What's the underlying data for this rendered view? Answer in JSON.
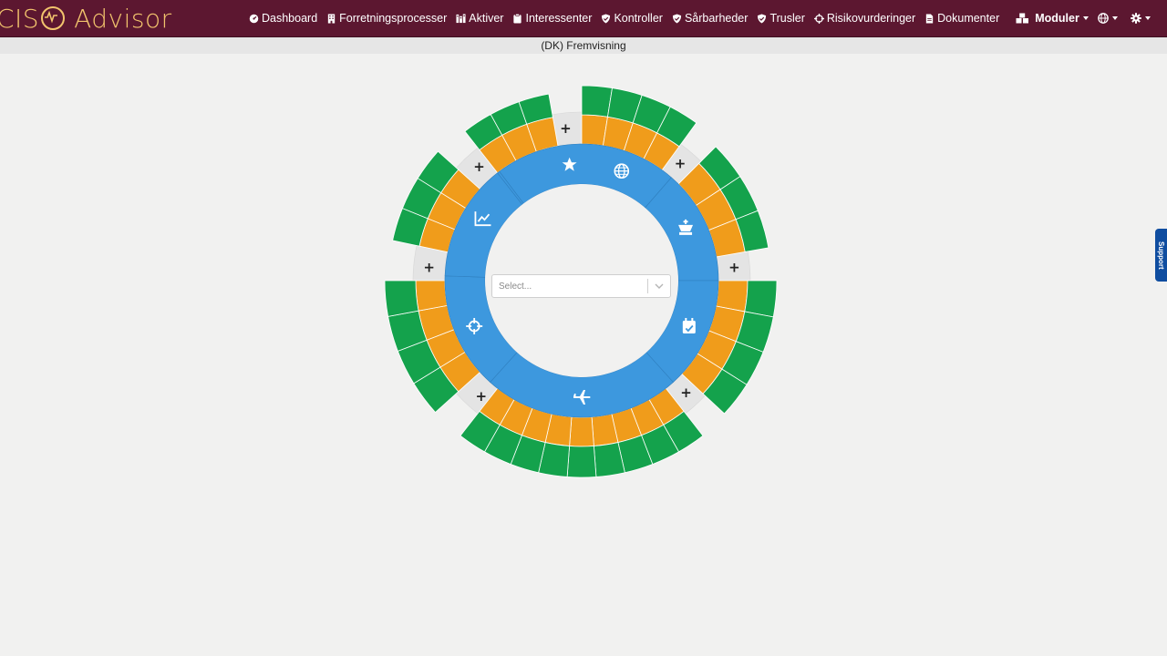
{
  "app": {
    "logo_left": "CIS",
    "logo_right": "Advisor"
  },
  "nav": {
    "items": [
      {
        "label": "Dashboard",
        "icon": "dashboard-icon"
      },
      {
        "label": "Forretningsprocesser",
        "icon": "building-icon"
      },
      {
        "label": "Aktiver",
        "icon": "assets-icon"
      },
      {
        "label": "Interessenter",
        "icon": "clipboard-icon"
      },
      {
        "label": "Kontroller",
        "icon": "shield-check-icon"
      },
      {
        "label": "Sårbarheder",
        "icon": "shield-check-icon"
      },
      {
        "label": "Trusler",
        "icon": "shield-check-icon"
      },
      {
        "label": "Risikovurderinger",
        "icon": "crosshair-icon"
      },
      {
        "label": "Dokumenter",
        "icon": "document-icon"
      }
    ],
    "modules_label": "Moduler",
    "modules_icon": "cubes-icon",
    "language_icon": "globe-icon",
    "settings_icon": "gear-icon"
  },
  "subheader": {
    "title": "(DK) Fremvisning"
  },
  "wheel": {
    "center_select": {
      "placeholder": "Select..."
    },
    "sector_icons": [
      {
        "name": "star-icon"
      },
      {
        "name": "globe-icon"
      },
      {
        "name": "chess-king-icon"
      },
      {
        "name": "calendar-check-icon"
      },
      {
        "name": "plane-icon"
      },
      {
        "name": "crosshair-icon"
      },
      {
        "name": "chart-line-icon"
      }
    ],
    "add_label": "+",
    "colors": {
      "inner_ring": "#3d98de",
      "middle_ring": "#f09c1b",
      "outer_ring": "#14a24c",
      "gap_ring": "#e4e4e4",
      "divider": "#ffffff"
    }
  },
  "support": {
    "label": "Support"
  },
  "colors": {
    "header_bg": "#5c1730",
    "logo": "#f2c46d",
    "page_bg": "#f1f1f0",
    "support_tab": "#0f4da0"
  }
}
